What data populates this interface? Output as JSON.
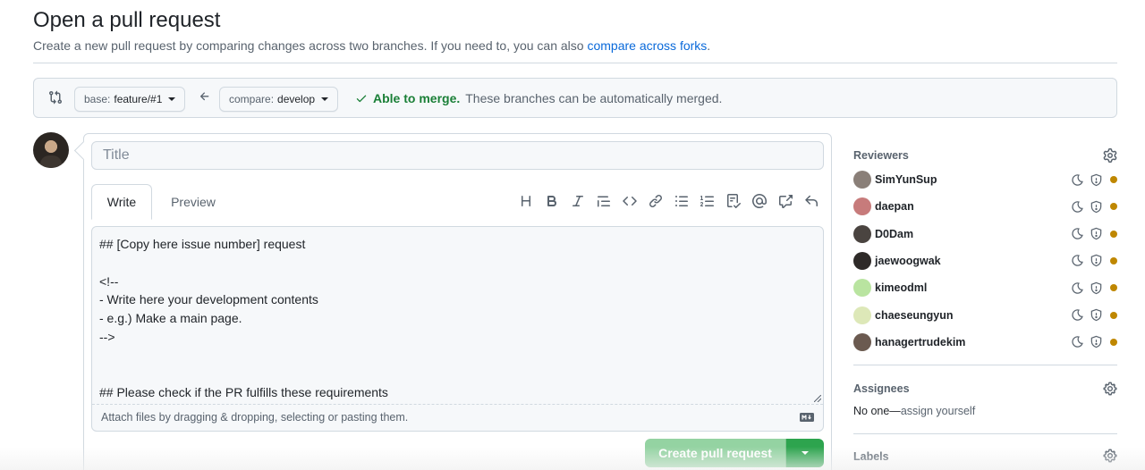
{
  "header": {
    "title": "Open a pull request",
    "subtitle": "Create a new pull request by comparing changes across two branches. If you need to, you can also ",
    "subtitle_link": "compare across forks",
    "subtitle_end": "."
  },
  "compare": {
    "base_label": "base:",
    "base_value": "feature/#1",
    "compare_label": "compare:",
    "compare_value": "develop",
    "merge_ok": "Able to merge.",
    "merge_text": "These branches can be automatically merged."
  },
  "form": {
    "title_placeholder": "Title",
    "tabs": [
      "Write",
      "Preview"
    ],
    "body": "## [Copy here issue number] request\n\n<!--\n- Write here your development contents\n- e.g.) Make a main page.\n-->\n\n\n## Please check if the PR fulfills these requirements",
    "attach_text": "Attach files by dragging & dropping, selecting or pasting them.",
    "create_label": "Create pull request"
  },
  "toolbar_icons": [
    "heading-icon",
    "bold-icon",
    "italic-icon",
    "quote-icon",
    "code-icon",
    "link-icon",
    "unordered-list-icon",
    "ordered-list-icon",
    "task-list-icon",
    "mention-icon",
    "cross-reference-icon",
    "reply-icon"
  ],
  "sidebar": {
    "reviewers_title": "Reviewers",
    "reviewers": [
      {
        "name": "SimYunSup",
        "color": "#8a7f78"
      },
      {
        "name": "daepan",
        "color": "#c77b7b"
      },
      {
        "name": "D0Dam",
        "color": "#4a4440"
      },
      {
        "name": "jaewoogwak",
        "color": "#2e2a28"
      },
      {
        "name": "kimeodml",
        "color": "#b9e4a0"
      },
      {
        "name": "chaeseungyun",
        "color": "#dde8b8"
      },
      {
        "name": "hanagertrudekim",
        "color": "#6b5a50"
      }
    ],
    "assignees_title": "Assignees",
    "assignees_none": "No one—",
    "assignees_link": "assign yourself",
    "labels_title": "Labels"
  },
  "colors": {
    "accent": "#0969da",
    "success": "#1a7f37",
    "pending": "#bf8700",
    "button_disabled": "#94d3a2"
  }
}
